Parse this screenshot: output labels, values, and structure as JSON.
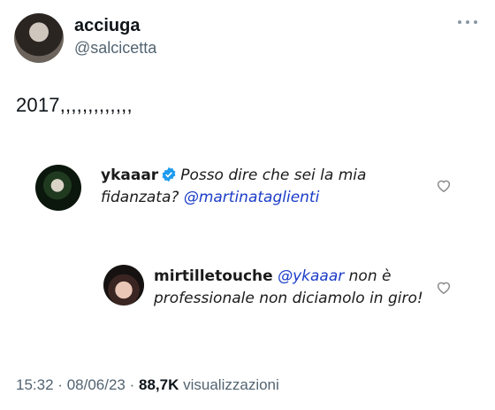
{
  "tweet": {
    "display_name": "acciuga",
    "handle": "@salcicetta",
    "text": "2017,,,,,,,,,,,,,",
    "time": "15:32",
    "date": "08/06/23",
    "separator": "·",
    "views_count": "88,7K",
    "views_label": "visualizzazioni"
  },
  "comments": [
    {
      "user": "ykaaar",
      "verified": true,
      "text_before": "Posso dire che sei la mia fidanzata?",
      "mention": "@martinataglienti",
      "text_after": ""
    },
    {
      "user": "mirtilletouche",
      "verified": false,
      "text_before": "",
      "mention": "@ykaaar",
      "text_after": "non è professionale non diciamolo in giro!"
    }
  ],
  "icons": {
    "more": "more-horizontal-icon",
    "heart": "heart-outline-icon",
    "verified": "verified-badge-icon"
  },
  "colors": {
    "handle_gray": "#536471",
    "mention_blue": "#1b3cc8",
    "verified_blue": "#1d9bf0"
  }
}
